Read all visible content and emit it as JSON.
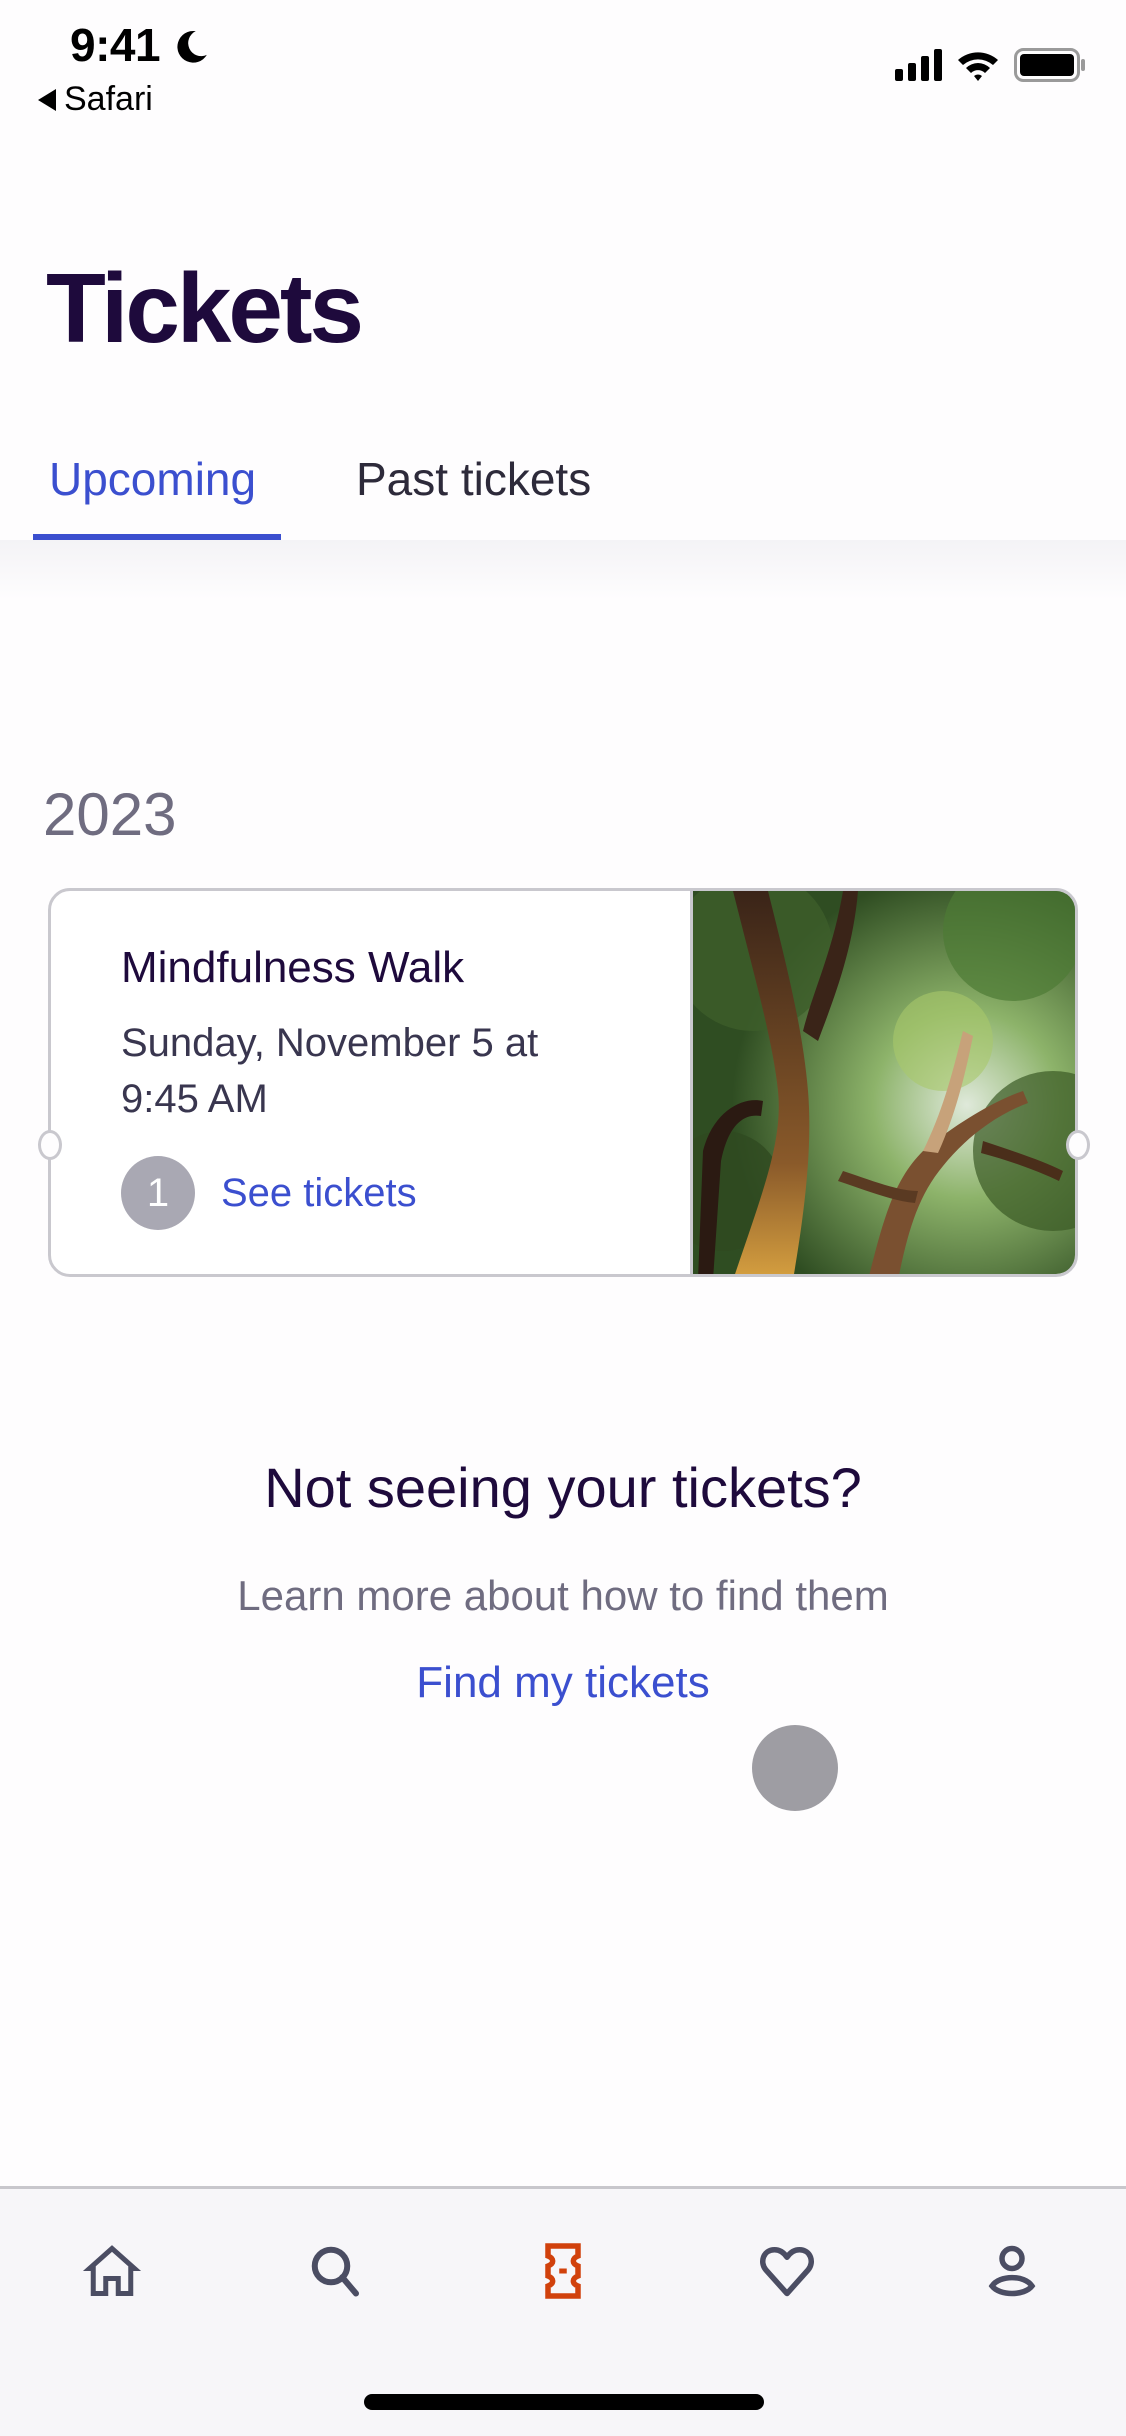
{
  "status_bar": {
    "time": "9:41",
    "back_app": "Safari",
    "icons": [
      "moon-icon",
      "signal-icon",
      "wifi-icon",
      "battery-icon"
    ]
  },
  "header": {
    "title": "Tickets"
  },
  "tabs": [
    {
      "label": "Upcoming",
      "active": true
    },
    {
      "label": "Past tickets",
      "active": false
    }
  ],
  "section": {
    "year": "2023"
  },
  "ticket_card": {
    "event_name": "Mindfulness Walk",
    "date_line": "Sunday, November 5 at 9:45 AM",
    "ticket_count": "1",
    "action_label": "See tickets",
    "image": "tree-canopy-photo"
  },
  "help": {
    "title": "Not seeing your tickets?",
    "subtitle": "Learn more about how to find them",
    "link_label": "Find my tickets"
  },
  "bottom_nav": [
    {
      "name": "home",
      "icon": "home-icon",
      "active": false
    },
    {
      "name": "search",
      "icon": "search-icon",
      "active": false
    },
    {
      "name": "tickets",
      "icon": "ticket-icon",
      "active": true
    },
    {
      "name": "likes",
      "icon": "heart-icon",
      "active": false
    },
    {
      "name": "profile",
      "icon": "user-icon",
      "active": false
    }
  ],
  "colors": {
    "brand_dark": "#1e0a3c",
    "link_blue": "#3b4fcf",
    "active_nav": "#d1410c",
    "icon_gray": "#4b4d63",
    "muted_text": "#6f6c80"
  }
}
